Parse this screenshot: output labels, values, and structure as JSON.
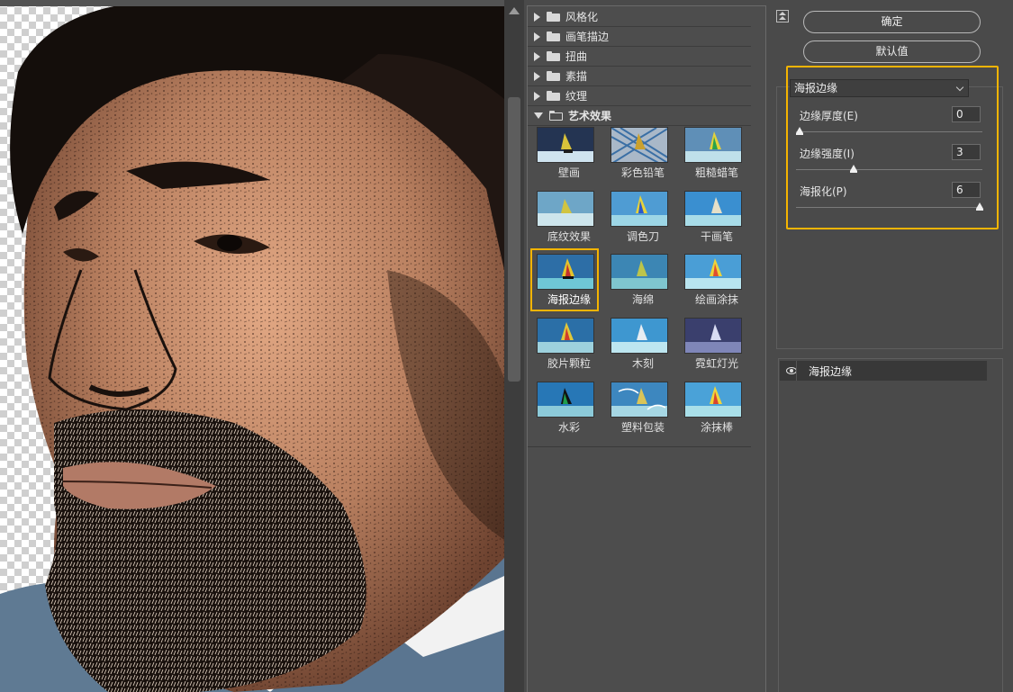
{
  "categories": [
    {
      "label": "风格化",
      "expanded": false
    },
    {
      "label": "画笔描边",
      "expanded": false
    },
    {
      "label": "扭曲",
      "expanded": false
    },
    {
      "label": "素描",
      "expanded": false
    },
    {
      "label": "纹理",
      "expanded": false
    },
    {
      "label": "艺术效果",
      "expanded": true
    }
  ],
  "filters": [
    {
      "label": "壁画",
      "icon": "mural-thumbnail"
    },
    {
      "label": "彩色铅笔",
      "icon": "colored-pencil-thumbnail"
    },
    {
      "label": "粗糙蜡笔",
      "icon": "rough-pastels-thumbnail"
    },
    {
      "label": "底纹效果",
      "icon": "underpainting-thumbnail"
    },
    {
      "label": "调色刀",
      "icon": "palette-knife-thumbnail"
    },
    {
      "label": "干画笔",
      "icon": "dry-brush-thumbnail"
    },
    {
      "label": "海报边缘",
      "icon": "poster-edges-thumbnail",
      "selected": true
    },
    {
      "label": "海绵",
      "icon": "sponge-thumbnail"
    },
    {
      "label": "绘画涂抹",
      "icon": "paint-daubs-thumbnail"
    },
    {
      "label": "胶片颗粒",
      "icon": "film-grain-thumbnail"
    },
    {
      "label": "木刻",
      "icon": "cutout-thumbnail"
    },
    {
      "label": "霓虹灯光",
      "icon": "neon-glow-thumbnail"
    },
    {
      "label": "水彩",
      "icon": "watercolor-thumbnail"
    },
    {
      "label": "塑料包装",
      "icon": "plastic-wrap-thumbnail"
    },
    {
      "label": "涂抹棒",
      "icon": "smudge-stick-thumbnail"
    }
  ],
  "buttons": {
    "ok": "确定",
    "default": "默认值"
  },
  "settings": {
    "selected_filter": "海报边缘",
    "params": [
      {
        "label": "边缘厚度(E)",
        "value": "0",
        "min": 0,
        "max": 10
      },
      {
        "label": "边缘强度(I)",
        "value": "3",
        "min": 0,
        "max": 10
      },
      {
        "label": "海报化(P)",
        "value": "6",
        "min": 0,
        "max": 6
      }
    ]
  },
  "layers": [
    {
      "label": "海报边缘",
      "visible": true
    }
  ],
  "colors": {
    "accent": "#f5b400",
    "panel": "#4a4a4a"
  }
}
